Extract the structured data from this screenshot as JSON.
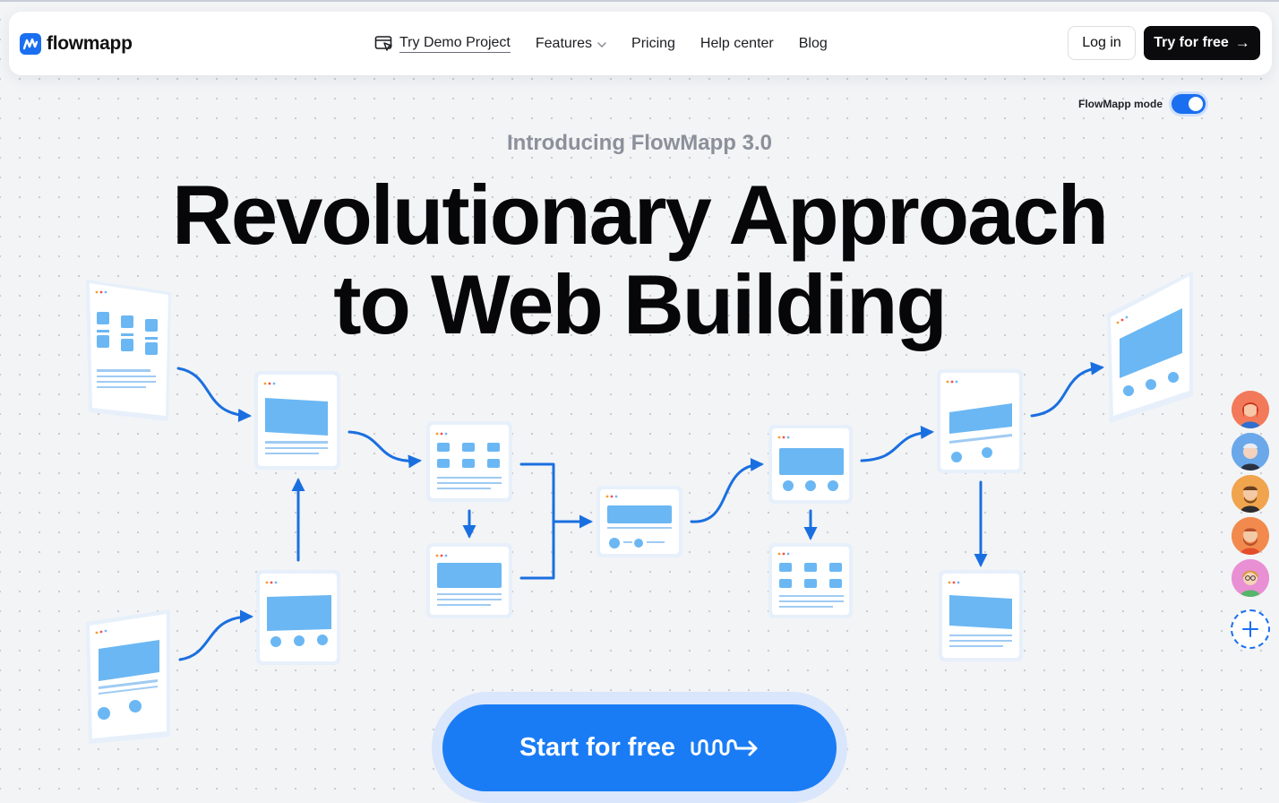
{
  "brand": {
    "name": "flowmapp",
    "accent": "#1a6ff0"
  },
  "nav": {
    "demo_label": "Try Demo Project",
    "features_label": "Features",
    "pricing_label": "Pricing",
    "help_label": "Help center",
    "blog_label": "Blog",
    "login_label": "Log in",
    "try_label": "Try for free"
  },
  "mode": {
    "label": "FlowMapp mode",
    "enabled": true
  },
  "hero": {
    "intro": "Introducing FlowMapp 3.0",
    "headline_line1": "Revolutionary Approach",
    "headline_line2": "to Web Building",
    "cta_label": "Start for free"
  },
  "collaborators": [
    {
      "name": "avatar-1",
      "color": "#f27a5a"
    },
    {
      "name": "avatar-2",
      "color": "#6aa8ea"
    },
    {
      "name": "avatar-3",
      "color": "#f0a44d"
    },
    {
      "name": "avatar-4",
      "color": "#f28a4e"
    },
    {
      "name": "avatar-5",
      "color": "#e98fd3"
    }
  ],
  "icons": {
    "logo": "flowmapp-logo-icon",
    "demo": "cursor-window-icon",
    "features": "chevron-down-icon",
    "try": "arrow-right-icon",
    "cta": "squiggle-arrow-icon",
    "add": "plus-icon"
  }
}
